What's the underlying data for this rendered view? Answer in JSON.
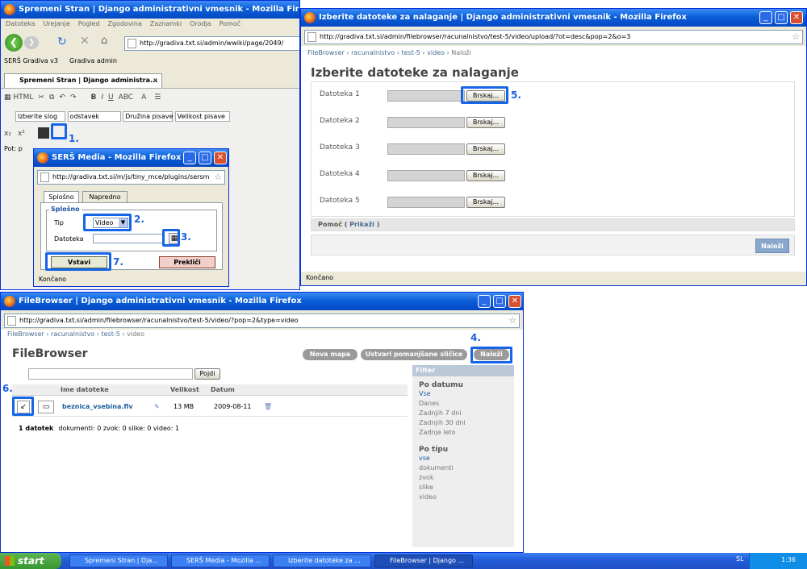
{
  "main": {
    "title": "Spremeni Stran | Django administrativni vmesnik - Mozilla Firefox",
    "menu": [
      "Datoteka",
      "Urejanje",
      "Pogled",
      "Zgodovina",
      "Zaznamki",
      "Orodja",
      "Pomoč"
    ],
    "url": "http://gradiva.txt.si/admin/wwiki/page/2049/",
    "bookmarks": [
      "SERŠ Gradiva v3",
      "Gradiva admin"
    ],
    "tab": "Spremeni Stran | Django administra...",
    "format": "Izberite slog",
    "paragraph": "odstavek",
    "font_family": "Družina pisave",
    "font_size": "Velikost pisave",
    "path": "Pot: p"
  },
  "media": {
    "title": "SERŠ Media - Mozilla Firefox",
    "url": "http://gradiva.txt.si/m/js/tiny_mce/plugins/sersm",
    "tabs": [
      "Splošno",
      "Napredno"
    ],
    "legend": "Splošno",
    "type_label": "Tip",
    "type_value": "Video",
    "file_label": "Datoteka",
    "insert": "Vstavi",
    "cancel": "Prekliči",
    "status": "Končano"
  },
  "upload": {
    "title": "Izberite datoteke za nalaganje | Django administrativni vmesnik - Mozilla Firefox",
    "url": "http://gradiva.txt.si/admin/filebrowser/racunalnistvo/test-5/video/upload/?ot=desc&pop=2&o=3",
    "breadcrumb": [
      "FileBrowser",
      "racunalnistvo",
      "test-5",
      "video",
      "Naloži"
    ],
    "heading": "Izberite datoteke za nalaganje",
    "rows": [
      "Datoteka 1",
      "Datoteka 2",
      "Datoteka 3",
      "Datoteka 4",
      "Datoteka 5"
    ],
    "browse": "Brskaj...",
    "help": "Pomoč",
    "show": "Prikaži",
    "upload_btn": "Naloži",
    "status": "Končano"
  },
  "fb": {
    "title": "FileBrowser | Django administrativni vmesnik - Mozilla Firefox",
    "url": "http://gradiva.txt.si/admin/filebrowser/racunalnistvo/test-5/video/?pop=2&type=video",
    "breadcrumb": [
      "FileBrowser",
      "racunalnistvo",
      "test-5",
      "video"
    ],
    "heading": "FileBrowser",
    "btn_folder": "Nova mapa",
    "btn_thumbs": "Ustvari pomanjšane sličice",
    "btn_upload": "Naloži",
    "search_btn": "Pojdi",
    "col_name": "Ime datoteke",
    "col_size": "Velikost",
    "col_date": "Datum",
    "file_name": "beznica_vsebina.flv",
    "file_size": "13 MB",
    "file_date": "2009-08-11",
    "summary_count": "1 datotek",
    "summary_rest": "dokumenti: 0  zvok: 0  slike: 0  video: 1",
    "filter_title": "Filter",
    "by_date": "Po datumu",
    "date_items": [
      "Vse",
      "Danes",
      "Zadnjih 7 dni",
      "Zadnjih 30 dni",
      "Zadnje leto"
    ],
    "by_type": "Po tipu",
    "type_items": [
      "vse",
      "dokumenti",
      "zvok",
      "slike",
      "video"
    ]
  },
  "steps": [
    "1.",
    "2.",
    "3.",
    "4.",
    "5.",
    "6.",
    "7."
  ],
  "taskbar": {
    "start": "start",
    "items": [
      "Spremeni Stran | Dja...",
      "SERŠ Media - Mozilla ...",
      "Izberite datoteke za ...",
      "FileBrowser | Django ..."
    ],
    "lang": "SL",
    "time": "1:36"
  }
}
